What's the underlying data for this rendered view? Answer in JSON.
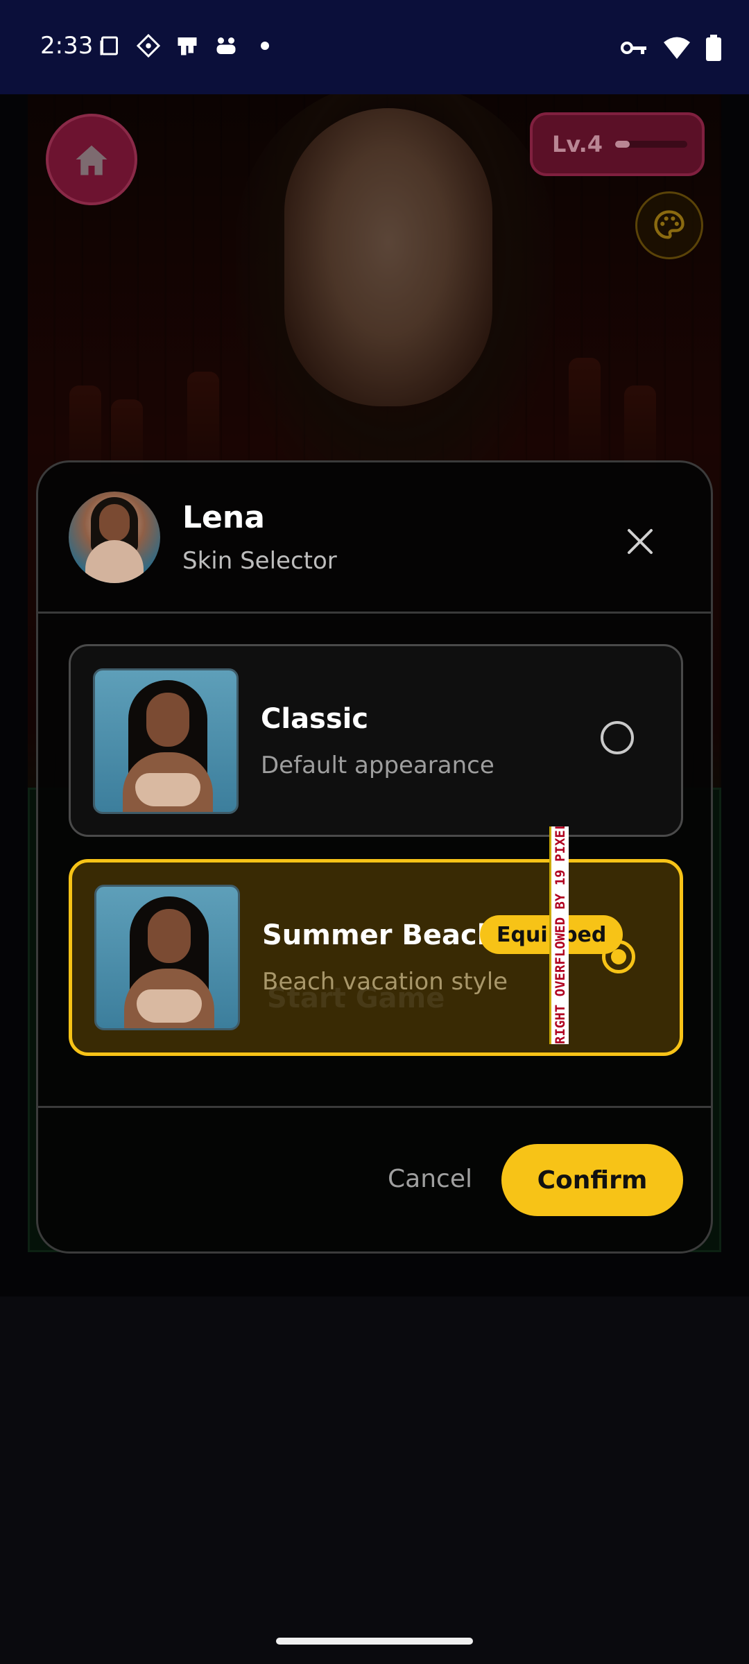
{
  "status_bar": {
    "time": "2:33",
    "left_icons": [
      "screen-icon",
      "diamond-icon",
      "cloud-print-icon",
      "controller-icon",
      "dot-icon"
    ],
    "right_icons": [
      "vpn-key-icon",
      "wifi-icon",
      "battery-icon"
    ]
  },
  "game": {
    "level_label": "Lv.4",
    "level_progress": 0.2,
    "start_hint": "Start Game"
  },
  "dialog": {
    "character_name": "Lena",
    "subtitle": "Skin Selector",
    "skins": [
      {
        "title": "Classic",
        "description": "Default appearance",
        "selected": false
      },
      {
        "title": "Summer Beach",
        "description": "Beach vacation style",
        "badge": "Equipped",
        "selected": true
      }
    ],
    "overflow_warning": "RIGHT OVERFLOWED BY 19 PIXELS",
    "cancel_label": "Cancel",
    "confirm_label": "Confirm"
  },
  "colors": {
    "accent": "#f7c317",
    "status_bar_bg": "#0b0f3a",
    "home_button": "#6d1330"
  }
}
